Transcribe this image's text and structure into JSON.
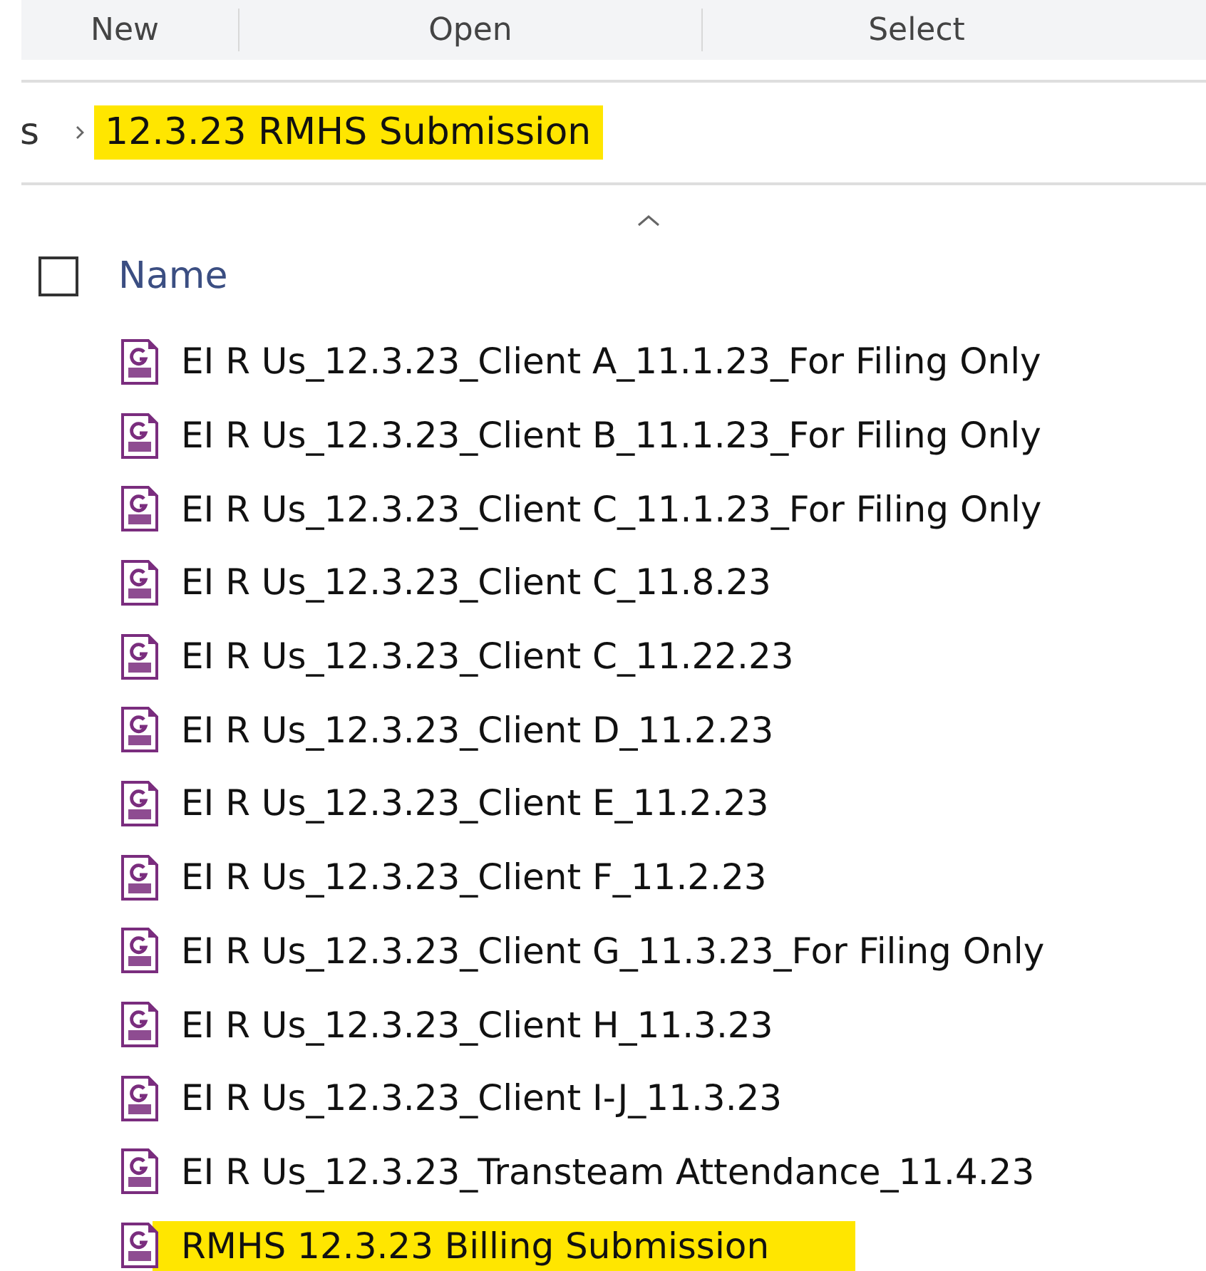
{
  "toolbar": {
    "groups": [
      "New",
      "Open",
      "Select"
    ]
  },
  "breadcrumb": {
    "items": [
      {
        "label": "s",
        "highlighted": false
      },
      {
        "label": "12.3.23 RMHS Submission",
        "highlighted": true
      }
    ]
  },
  "header": {
    "select_all_checked": false,
    "column": "Name"
  },
  "files": [
    {
      "name": "EI R Us_12.3.23_Client A_11.1.23_For Filing Only",
      "highlighted": false
    },
    {
      "name": "EI R Us_12.3.23_Client B_11.1.23_For Filing Only",
      "highlighted": false
    },
    {
      "name": "EI R Us_12.3.23_Client C_11.1.23_For Filing Only",
      "highlighted": false
    },
    {
      "name": "EI R Us_12.3.23_Client C_11.8.23",
      "highlighted": false
    },
    {
      "name": "EI R Us_12.3.23_Client C_11.22.23",
      "highlighted": false
    },
    {
      "name": "EI R Us_12.3.23_Client D_11.2.23",
      "highlighted": false
    },
    {
      "name": "EI R Us_12.3.23_Client E_11.2.23",
      "highlighted": false
    },
    {
      "name": "EI R Us_12.3.23_Client F_11.2.23",
      "highlighted": false
    },
    {
      "name": "EI R Us_12.3.23_Client G_11.3.23_For Filing Only",
      "highlighted": false
    },
    {
      "name": "EI R Us_12.3.23_Client H_11.3.23",
      "highlighted": false
    },
    {
      "name": "EI R Us_12.3.23_Client I-J_11.3.23",
      "highlighted": false
    },
    {
      "name": "EI R Us_12.3.23_Transteam Attendance_11.4.23",
      "highlighted": false
    },
    {
      "name": "RMHS 12.3.23 Billing Submission",
      "highlighted": true
    }
  ]
}
